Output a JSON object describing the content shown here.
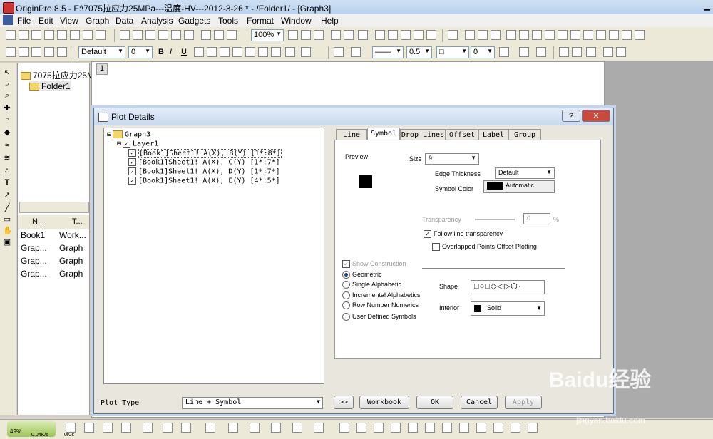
{
  "window": {
    "title": "OriginPro 8.5 - F:\\7075拉应力25MPa---温度-HV---2012-3-26 * - /Folder1/ - [Graph3]"
  },
  "menu": [
    "File",
    "Edit",
    "View",
    "Graph",
    "Data",
    "Analysis",
    "Gadgets",
    "Tools",
    "Format",
    "Window",
    "Help"
  ],
  "toolbar": {
    "zoom": "100%",
    "font": "Default",
    "font_size": "0",
    "line_width": "0.5",
    "bold": "B",
    "italic": "I",
    "underline": "U"
  },
  "project": {
    "root": "7075拉应力25M",
    "folder": "Folder1",
    "col_name": "N...",
    "col_type": "T...",
    "items": [
      {
        "name": "Book1",
        "type": "Work..."
      },
      {
        "name": "Grap...",
        "type": "Graph"
      },
      {
        "name": "Grap...",
        "type": "Graph"
      },
      {
        "name": "Grap...",
        "type": "Graph"
      }
    ]
  },
  "mdi_tab": "1",
  "dialog": {
    "title": "Plot Details",
    "help": "?",
    "tree": {
      "graph": "Graph3",
      "layer": "Layer1",
      "plots": [
        "[Book1]Sheet1! A(X), B(Y) [1*:8*]",
        "[Book1]Sheet1! A(X), C(Y) [1*:7*]",
        "[Book1]Sheet1! A(X), D(Y) [1*:7*]",
        "[Book1]Sheet1! A(X), E(Y) [4*:5*]"
      ]
    },
    "tabs": [
      "Line",
      "Symbol",
      "Drop Lines",
      "Offset",
      "Label",
      "Group"
    ],
    "active_tab": "Symbol",
    "symbol": {
      "preview_label": "Preview",
      "size_label": "Size",
      "size_value": "9",
      "edge_label": "Edge Thickness",
      "edge_value": "Default",
      "color_label": "Symbol Color",
      "color_value": "Automatic",
      "transparency_label": "Transparency",
      "transparency_value": "0",
      "percent": "%",
      "follow_label": "Follow line transparency",
      "overlap_label": "Overlapped Points Offset Plotting",
      "show_construction": "Show Construction",
      "radios": [
        "Geometric",
        "Single Alphabetic",
        "Incremental Alphabetics",
        "Row Number Numerics",
        "User Defined Symbols"
      ],
      "shape_label": "Shape",
      "shape_glyphs": "□○□◇◁▷⬡·",
      "interior_label": "Interior",
      "interior_value": "Solid"
    },
    "plot_type_label": "Plot Type",
    "plot_type_value": "Line + Symbol",
    "buttons": {
      "expand": ">>",
      "workbook": "Workbook",
      "ok": "OK",
      "cancel": "Cancel",
      "apply": "Apply"
    }
  },
  "taskbar": {
    "cpu": "49%",
    "net_down": "0.04K/s",
    "net_up": "0K/s"
  },
  "watermark": {
    "text": "Baidu经验",
    "url": "jingyan.baidu.com"
  },
  "colors": {
    "symbol": "#000000",
    "accent": "#1a3f8f"
  }
}
